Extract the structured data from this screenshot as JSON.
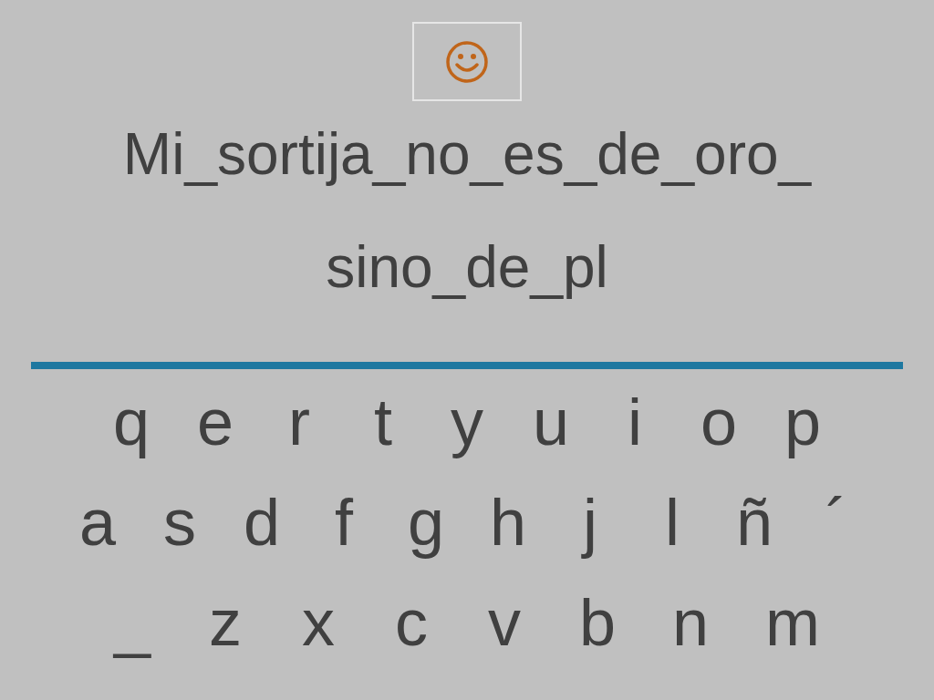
{
  "phrase_lines": [
    "Mi_sortija_no_es_de_oro_",
    "sino_de_pl"
  ],
  "keyboard_rows": [
    [
      "q",
      "e",
      "r",
      "t",
      "y",
      "u",
      "i",
      "o",
      "p"
    ],
    [
      "a",
      "s",
      "d",
      "f",
      "g",
      "h",
      "j",
      "l",
      "ñ",
      "´"
    ],
    [
      "_",
      "z",
      "x",
      "c",
      "v",
      "b",
      "n",
      "m"
    ]
  ]
}
